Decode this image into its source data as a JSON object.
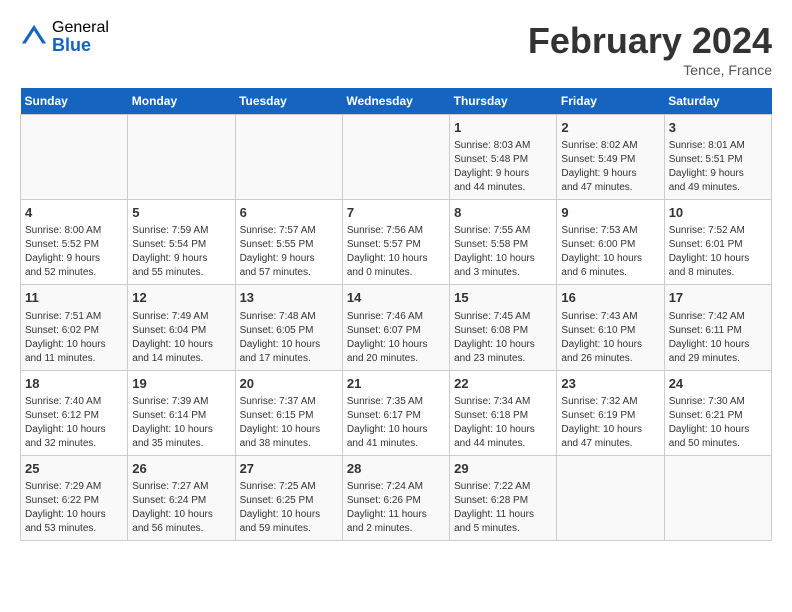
{
  "header": {
    "logo_general": "General",
    "logo_blue": "Blue",
    "month_title": "February 2024",
    "location": "Tence, France"
  },
  "days_of_week": [
    "Sunday",
    "Monday",
    "Tuesday",
    "Wednesday",
    "Thursday",
    "Friday",
    "Saturday"
  ],
  "weeks": [
    [
      {
        "num": "",
        "info": ""
      },
      {
        "num": "",
        "info": ""
      },
      {
        "num": "",
        "info": ""
      },
      {
        "num": "",
        "info": ""
      },
      {
        "num": "1",
        "info": "Sunrise: 8:03 AM\nSunset: 5:48 PM\nDaylight: 9 hours\nand 44 minutes."
      },
      {
        "num": "2",
        "info": "Sunrise: 8:02 AM\nSunset: 5:49 PM\nDaylight: 9 hours\nand 47 minutes."
      },
      {
        "num": "3",
        "info": "Sunrise: 8:01 AM\nSunset: 5:51 PM\nDaylight: 9 hours\nand 49 minutes."
      }
    ],
    [
      {
        "num": "4",
        "info": "Sunrise: 8:00 AM\nSunset: 5:52 PM\nDaylight: 9 hours\nand 52 minutes."
      },
      {
        "num": "5",
        "info": "Sunrise: 7:59 AM\nSunset: 5:54 PM\nDaylight: 9 hours\nand 55 minutes."
      },
      {
        "num": "6",
        "info": "Sunrise: 7:57 AM\nSunset: 5:55 PM\nDaylight: 9 hours\nand 57 minutes."
      },
      {
        "num": "7",
        "info": "Sunrise: 7:56 AM\nSunset: 5:57 PM\nDaylight: 10 hours\nand 0 minutes."
      },
      {
        "num": "8",
        "info": "Sunrise: 7:55 AM\nSunset: 5:58 PM\nDaylight: 10 hours\nand 3 minutes."
      },
      {
        "num": "9",
        "info": "Sunrise: 7:53 AM\nSunset: 6:00 PM\nDaylight: 10 hours\nand 6 minutes."
      },
      {
        "num": "10",
        "info": "Sunrise: 7:52 AM\nSunset: 6:01 PM\nDaylight: 10 hours\nand 8 minutes."
      }
    ],
    [
      {
        "num": "11",
        "info": "Sunrise: 7:51 AM\nSunset: 6:02 PM\nDaylight: 10 hours\nand 11 minutes."
      },
      {
        "num": "12",
        "info": "Sunrise: 7:49 AM\nSunset: 6:04 PM\nDaylight: 10 hours\nand 14 minutes."
      },
      {
        "num": "13",
        "info": "Sunrise: 7:48 AM\nSunset: 6:05 PM\nDaylight: 10 hours\nand 17 minutes."
      },
      {
        "num": "14",
        "info": "Sunrise: 7:46 AM\nSunset: 6:07 PM\nDaylight: 10 hours\nand 20 minutes."
      },
      {
        "num": "15",
        "info": "Sunrise: 7:45 AM\nSunset: 6:08 PM\nDaylight: 10 hours\nand 23 minutes."
      },
      {
        "num": "16",
        "info": "Sunrise: 7:43 AM\nSunset: 6:10 PM\nDaylight: 10 hours\nand 26 minutes."
      },
      {
        "num": "17",
        "info": "Sunrise: 7:42 AM\nSunset: 6:11 PM\nDaylight: 10 hours\nand 29 minutes."
      }
    ],
    [
      {
        "num": "18",
        "info": "Sunrise: 7:40 AM\nSunset: 6:12 PM\nDaylight: 10 hours\nand 32 minutes."
      },
      {
        "num": "19",
        "info": "Sunrise: 7:39 AM\nSunset: 6:14 PM\nDaylight: 10 hours\nand 35 minutes."
      },
      {
        "num": "20",
        "info": "Sunrise: 7:37 AM\nSunset: 6:15 PM\nDaylight: 10 hours\nand 38 minutes."
      },
      {
        "num": "21",
        "info": "Sunrise: 7:35 AM\nSunset: 6:17 PM\nDaylight: 10 hours\nand 41 minutes."
      },
      {
        "num": "22",
        "info": "Sunrise: 7:34 AM\nSunset: 6:18 PM\nDaylight: 10 hours\nand 44 minutes."
      },
      {
        "num": "23",
        "info": "Sunrise: 7:32 AM\nSunset: 6:19 PM\nDaylight: 10 hours\nand 47 minutes."
      },
      {
        "num": "24",
        "info": "Sunrise: 7:30 AM\nSunset: 6:21 PM\nDaylight: 10 hours\nand 50 minutes."
      }
    ],
    [
      {
        "num": "25",
        "info": "Sunrise: 7:29 AM\nSunset: 6:22 PM\nDaylight: 10 hours\nand 53 minutes."
      },
      {
        "num": "26",
        "info": "Sunrise: 7:27 AM\nSunset: 6:24 PM\nDaylight: 10 hours\nand 56 minutes."
      },
      {
        "num": "27",
        "info": "Sunrise: 7:25 AM\nSunset: 6:25 PM\nDaylight: 10 hours\nand 59 minutes."
      },
      {
        "num": "28",
        "info": "Sunrise: 7:24 AM\nSunset: 6:26 PM\nDaylight: 11 hours\nand 2 minutes."
      },
      {
        "num": "29",
        "info": "Sunrise: 7:22 AM\nSunset: 6:28 PM\nDaylight: 11 hours\nand 5 minutes."
      },
      {
        "num": "",
        "info": ""
      },
      {
        "num": "",
        "info": ""
      }
    ]
  ]
}
